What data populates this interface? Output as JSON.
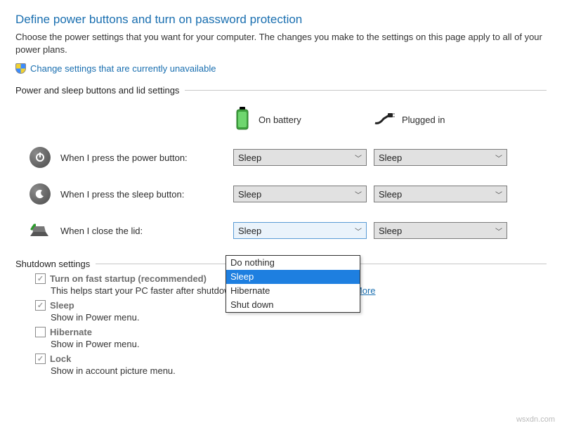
{
  "page": {
    "title": "Define power buttons and turn on password protection",
    "description": "Choose the power settings that you want for your computer. The changes you make to the settings on this page apply to all of your power plans.",
    "change_link": "Change settings that are currently unavailable"
  },
  "sectionA": {
    "label": "Power and sleep buttons and lid settings",
    "cols": {
      "battery": "On battery",
      "plugged": "Plugged in"
    },
    "rows": {
      "power": {
        "label": "When I press the power button:",
        "battery": "Sleep",
        "plugged": "Sleep"
      },
      "sleep": {
        "label": "When I press the sleep button:",
        "battery": "Sleep",
        "plugged": "Sleep"
      },
      "lid": {
        "label": "When I close the lid:",
        "battery": "Sleep",
        "plugged": "Sleep"
      }
    },
    "lid_dropdown": {
      "options": [
        "Do nothing",
        "Sleep",
        "Hibernate",
        "Shut down"
      ],
      "selected": "Sleep"
    }
  },
  "sectionB": {
    "label": "Shutdown settings",
    "fast": {
      "title": "Turn on fast startup (recommended)",
      "desc": "This helps start your PC faster after shutdown. Restart isn't affected.",
      "learn": "Learn More",
      "checked": true
    },
    "sleep": {
      "title": "Sleep",
      "desc": "Show in Power menu.",
      "checked": true
    },
    "hibernate": {
      "title": "Hibernate",
      "desc": "Show in Power menu.",
      "checked": false
    },
    "lock": {
      "title": "Lock",
      "desc": "Show in account picture menu.",
      "checked": true
    }
  },
  "watermark": "wsxdn.com"
}
